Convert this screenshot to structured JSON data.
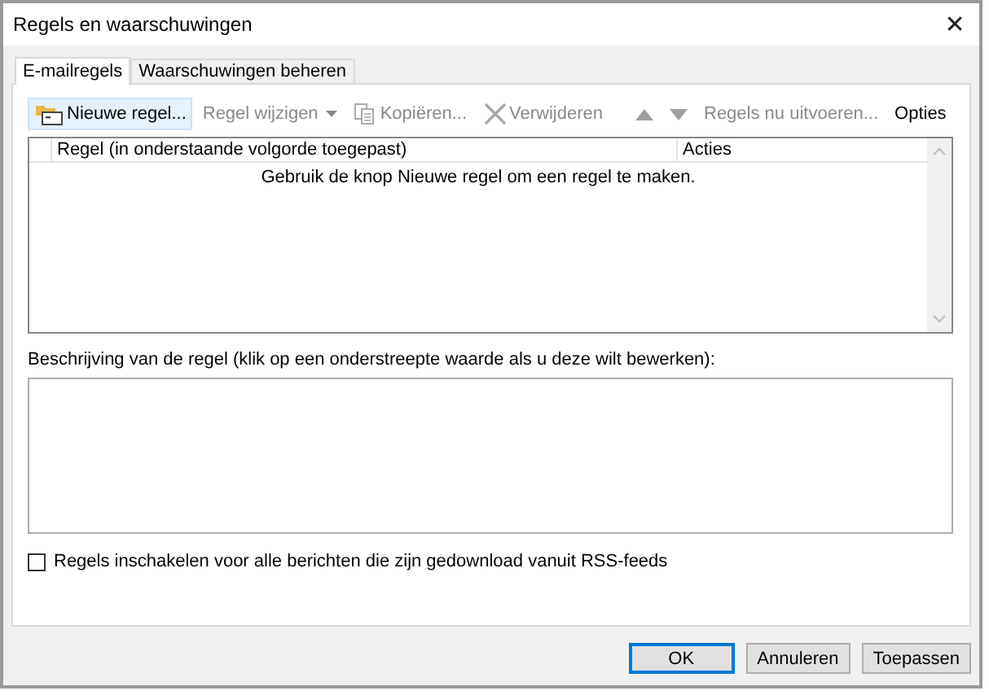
{
  "window": {
    "title": "Regels en waarschuwingen",
    "close": "✕"
  },
  "tabs": [
    {
      "label": "E-mailregels",
      "selected": true
    },
    {
      "label": "Waarschuwingen beheren",
      "selected": false
    }
  ],
  "toolbar": [
    {
      "kind": "new",
      "label": "Nieuwe regel...",
      "disabled": false,
      "highlighted": true
    },
    {
      "kind": "dropdown",
      "label": "Regel wijzigen",
      "disabled": true,
      "highlighted": false
    },
    {
      "kind": "copy",
      "label": "Kopiëren...",
      "disabled": true,
      "highlighted": false
    },
    {
      "kind": "delete",
      "label": "Verwijderen",
      "disabled": true,
      "highlighted": false
    },
    {
      "kind": "separator"
    },
    {
      "kind": "up",
      "disabled": true,
      "highlighted": false
    },
    {
      "kind": "down",
      "disabled": true,
      "highlighted": false
    },
    {
      "kind": "text",
      "label": "Regels nu uitvoeren...",
      "disabled": true,
      "highlighted": false
    },
    {
      "kind": "text",
      "label": "Opties",
      "disabled": false,
      "highlighted": false
    }
  ],
  "table": {
    "columns": [
      "Regel (in onderstaande volgorde toegepast)",
      "Acties"
    ],
    "empty_message": "Gebruik de knop Nieuwe regel om een regel te maken."
  },
  "description": {
    "label": "Beschrijving van de regel (klik op een onderstreepte waarde als u deze wilt bewerken):"
  },
  "rss_checkbox": {
    "label": "Regels inschakelen voor alle berichten die zijn gedownload vanuit RSS-feeds",
    "checked": false
  },
  "buttons": [
    {
      "label": "OK",
      "default": true
    },
    {
      "label": "Annuleren",
      "default": false
    },
    {
      "label": "Toepassen",
      "default": false
    }
  ]
}
